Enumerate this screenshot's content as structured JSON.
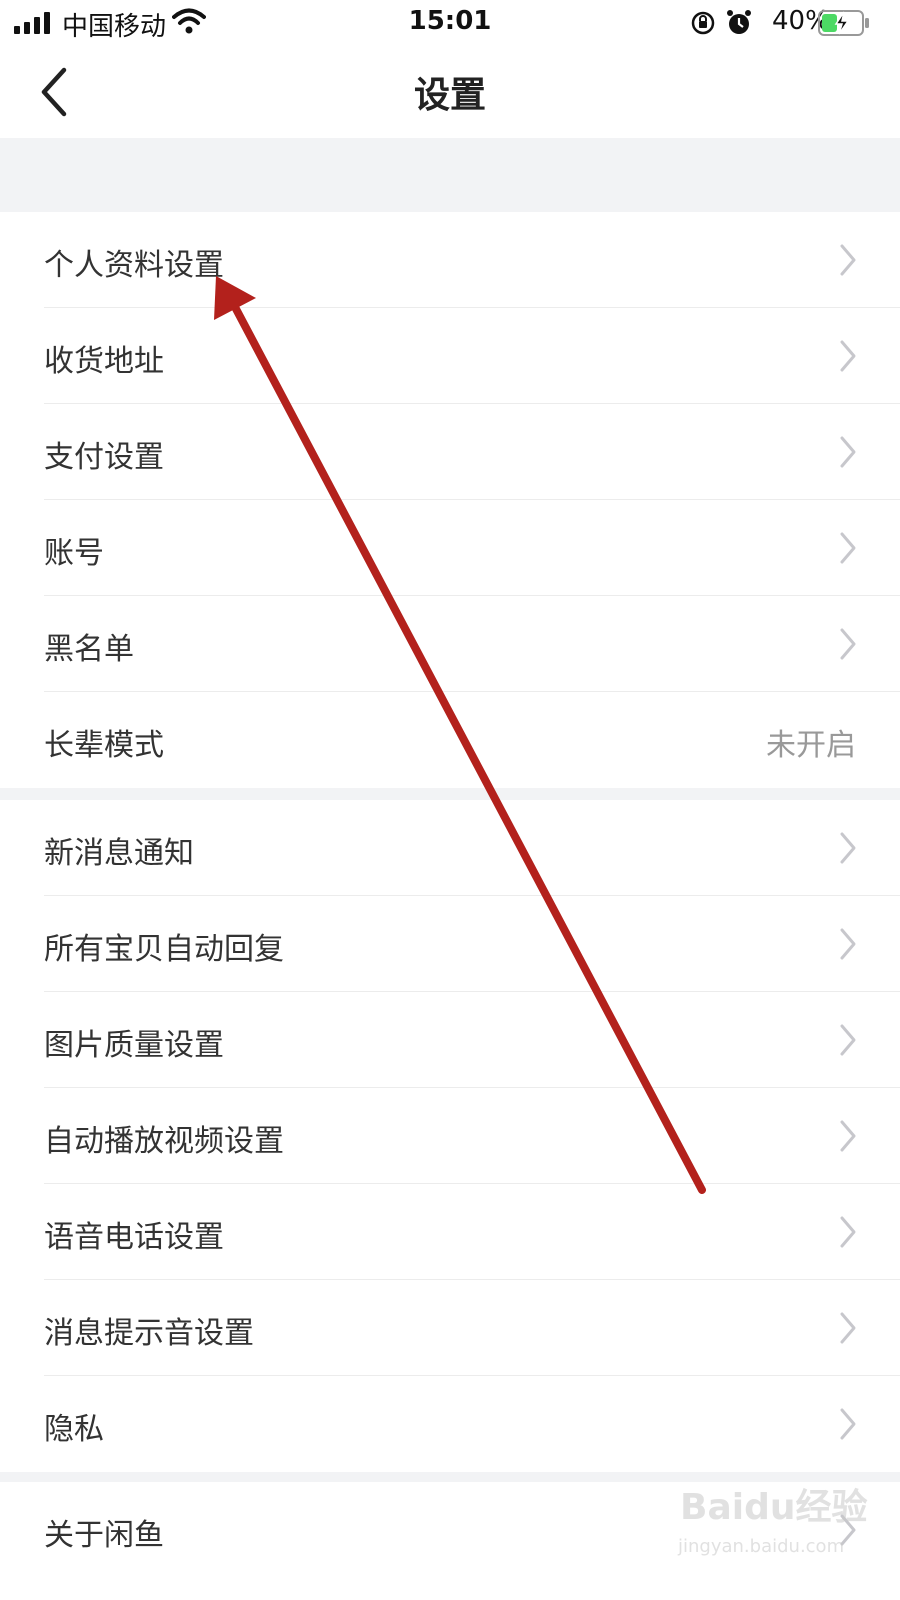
{
  "status_bar": {
    "carrier": "中国移动",
    "time": "15:01",
    "battery": "40%",
    "icons": [
      "signal-icon",
      "wifi-icon",
      "rotation-lock-icon",
      "alarm-icon",
      "battery-charging-icon"
    ],
    "battery_level": 0.4,
    "battery_color": "#4cd964"
  },
  "nav": {
    "title": "设置",
    "back_icon": "back-arrow-icon"
  },
  "groups": [
    {
      "items": [
        {
          "label": "个人资料设置",
          "chevron": true
        },
        {
          "label": "收货地址",
          "chevron": true
        },
        {
          "label": "支付设置",
          "chevron": true
        },
        {
          "label": "账号",
          "chevron": true
        },
        {
          "label": "黑名单",
          "chevron": true
        },
        {
          "label": "长辈模式",
          "value": "未开启",
          "chevron": false
        }
      ]
    },
    {
      "items": [
        {
          "label": "新消息通知",
          "chevron": true
        },
        {
          "label": "所有宝贝自动回复",
          "chevron": true
        },
        {
          "label": "图片质量设置",
          "chevron": true
        },
        {
          "label": "自动播放视频设置",
          "chevron": true
        },
        {
          "label": "语音电话设置",
          "chevron": true
        },
        {
          "label": "消息提示音设置",
          "chevron": true
        },
        {
          "label": "隐私",
          "chevron": true
        }
      ]
    },
    {
      "items": [
        {
          "label": "关于闲鱼",
          "chevron": true
        }
      ]
    }
  ],
  "watermark": {
    "brand": "Baidu经验",
    "url": "jingyan.baidu.com"
  },
  "annotation": {
    "type": "arrow",
    "color": "#b3211c"
  },
  "colors": {
    "background_gap": "#f2f3f5",
    "text_primary": "#333333",
    "text_secondary": "#999999",
    "chevron": "#c7c7cc"
  }
}
